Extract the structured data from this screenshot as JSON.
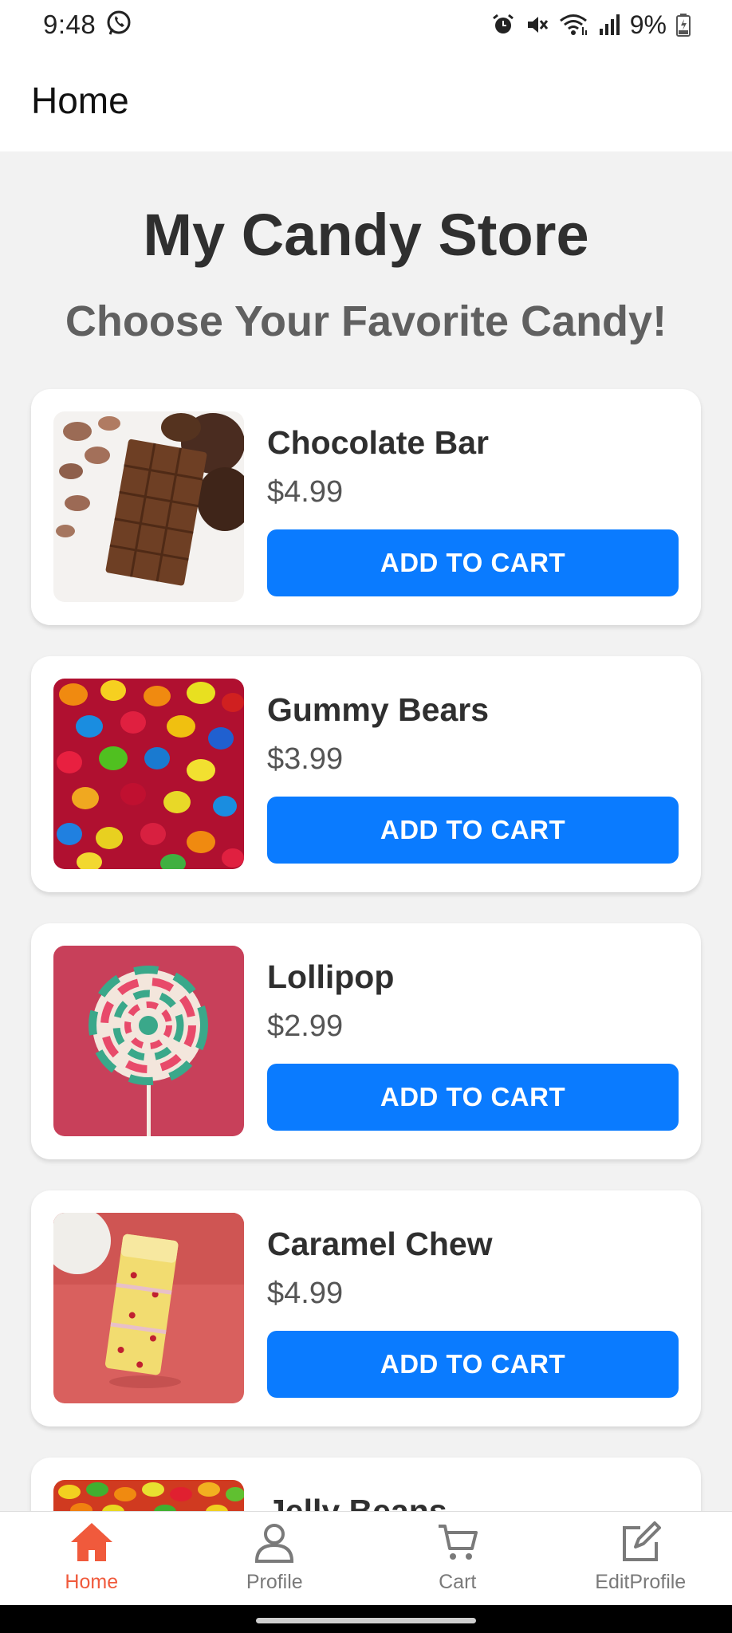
{
  "status_bar": {
    "time": "9:48",
    "battery": "9%",
    "icons": [
      "whatsapp-icon",
      "alarm-icon",
      "mute-icon",
      "wifi-icon",
      "signal-icon",
      "battery-icon"
    ]
  },
  "header": {
    "title": "Home"
  },
  "store": {
    "title": "My Candy Store",
    "subtitle": "Choose Your Favorite Candy!"
  },
  "products": [
    {
      "name": "Chocolate Bar",
      "price": "$4.99",
      "button": "ADD TO CART"
    },
    {
      "name": "Gummy Bears",
      "price": "$3.99",
      "button": "ADD TO CART"
    },
    {
      "name": "Lollipop",
      "price": "$2.99",
      "button": "ADD TO CART"
    },
    {
      "name": "Caramel Chew",
      "price": "$4.99",
      "button": "ADD TO CART"
    },
    {
      "name": "Jelly Beans",
      "price": "",
      "button": ""
    }
  ],
  "bottom_nav": {
    "items": [
      {
        "label": "Home",
        "icon": "home-icon",
        "active": true
      },
      {
        "label": "Profile",
        "icon": "profile-icon",
        "active": false
      },
      {
        "label": "Cart",
        "icon": "cart-icon",
        "active": false
      },
      {
        "label": "EditProfile",
        "icon": "edit-icon",
        "active": false
      }
    ]
  },
  "colors": {
    "accent": "#0a7bff",
    "active_nav": "#f05a3c",
    "background": "#f2f2f2",
    "card": "#ffffff"
  }
}
